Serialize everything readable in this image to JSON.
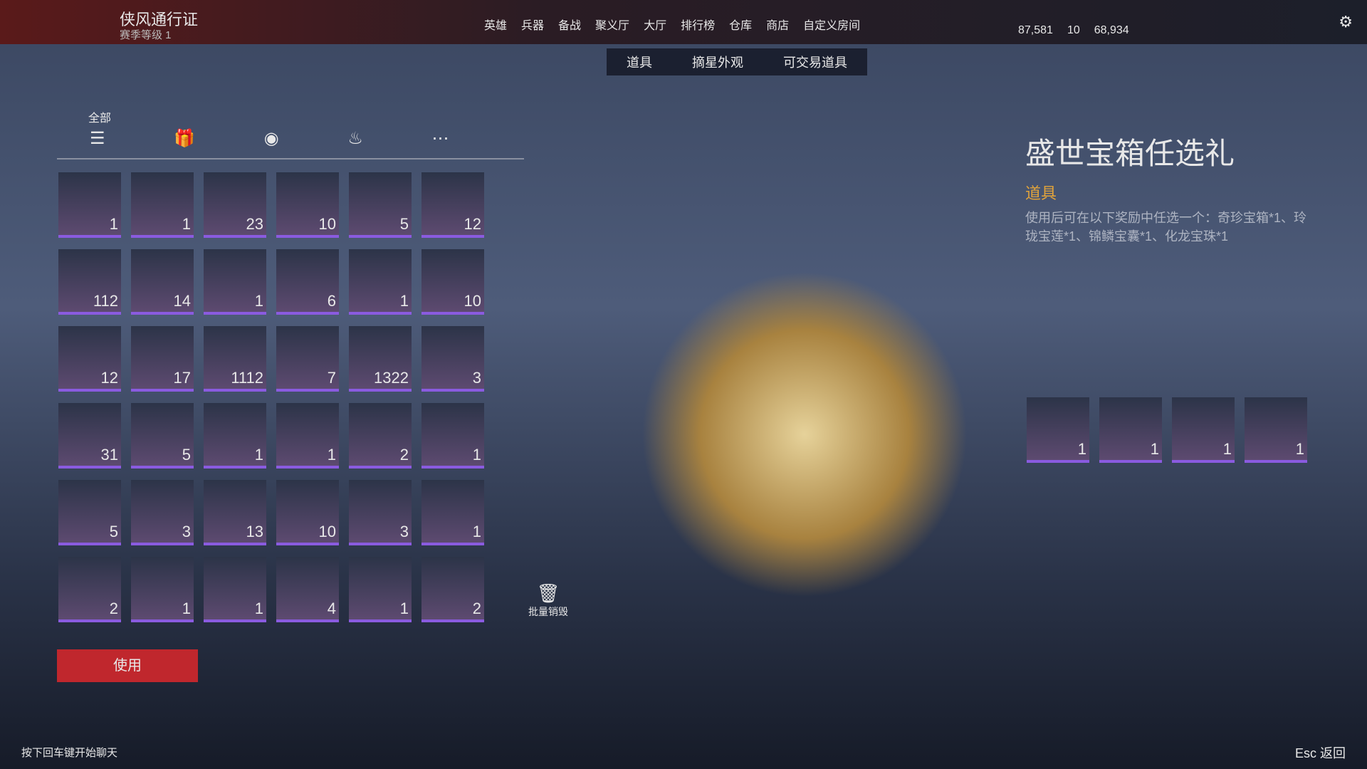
{
  "pass": {
    "title": "侠风通行证",
    "level": "赛季等级 1"
  },
  "nav": [
    "英雄",
    "兵器",
    "备战",
    "聚义厅",
    "大厅",
    "排行榜",
    "仓库",
    "商店",
    "自定义房间"
  ],
  "cur": [
    "87,581",
    "10",
    "68,934"
  ],
  "tabs": [
    "道具",
    "摘星外观",
    "可交易道具"
  ],
  "cat": "全部",
  "counts": [
    "1",
    "1",
    "23",
    "10",
    "5",
    "12",
    "112",
    "14",
    "1",
    "6",
    "1",
    "10",
    "12",
    "17",
    "1112",
    "7",
    "1322",
    "3",
    "31",
    "5",
    "1",
    "1",
    "2",
    "1",
    "5",
    "3",
    "13",
    "10",
    "3",
    "1",
    "2",
    "1",
    "1",
    "4",
    "1",
    "2"
  ],
  "d": {
    "name": "盛世宝箱任选礼",
    "type": "道具",
    "desc": "使用后可在以下奖励中任选一个：奇珍宝箱*1、玲珑宝莲*1、锦鳞宝囊*1、化龙宝珠*1",
    "rewards": [
      "1",
      "1",
      "1",
      "1"
    ]
  },
  "use": "使用",
  "destroy": "批量销毁",
  "chat": "按下回车键开始聊天",
  "esc": "返回"
}
